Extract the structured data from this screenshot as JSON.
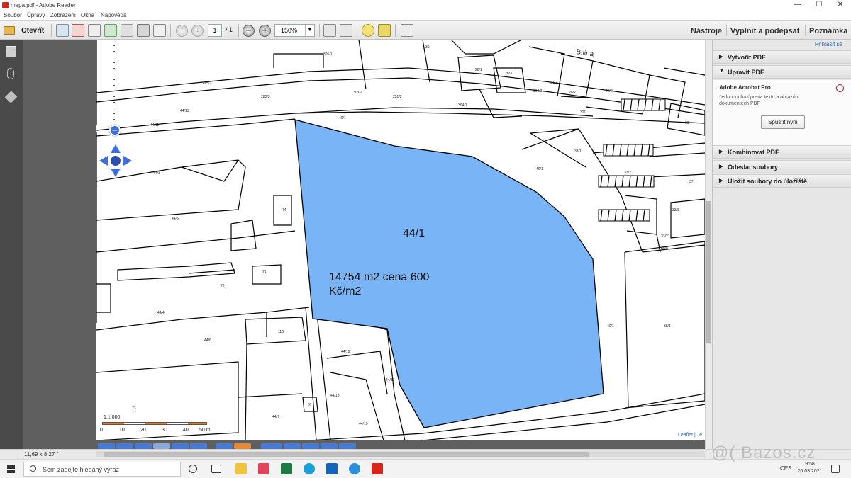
{
  "window": {
    "title": "mapa.pdf - Adobe Reader",
    "minimize": "—",
    "maximize": "☐",
    "close": "✕"
  },
  "menu": {
    "items": [
      "Soubor",
      "Úpravy",
      "Zobrazení",
      "Okna",
      "Nápověda"
    ]
  },
  "toolbar": {
    "open_label": "Otevřít",
    "page_current": "1",
    "page_total": "/ 1",
    "zoom": "150%",
    "minus": "−",
    "plus": "+",
    "tools_link": "Nástroje",
    "fill_sign_link": "Vyplnit a podepsat",
    "comment_link": "Poznámka"
  },
  "right_panel": {
    "signin": "Přihlásit se",
    "sections": [
      {
        "label": "Vytvořit PDF",
        "expanded": false
      },
      {
        "label": "Upravit PDF",
        "expanded": true
      },
      {
        "label": "Kombinovat PDF",
        "expanded": false
      },
      {
        "label": "Odeslat soubory",
        "expanded": false
      },
      {
        "label": "Uložit soubory do úložiště",
        "expanded": false
      }
    ],
    "expanded_title": "Adobe Acrobat Pro",
    "expanded_desc": "Jednoduchá úprava textu a obrazů v dokumentech PDF",
    "run_button": "Spustit nyní"
  },
  "map": {
    "parcel_label": "44/1",
    "parcel_text_line1": "14754 m2 cena 600",
    "parcel_text_line2": "Kč/m2",
    "parcel_color": "#79b4f6",
    "street_label": "Bílina",
    "scale_text": "1:1 000",
    "scale_ticks": [
      "0",
      "10",
      "20",
      "30",
      "40",
      "50 m"
    ],
    "attribution": "Leaflet | Je",
    "numbers": [
      "30",
      "305/1",
      "28/1",
      "28/3",
      "31/2",
      "28/2",
      "284/1",
      "280/3",
      "303/2",
      "251/2",
      "304/1",
      "304/3",
      "28/2",
      "32/1",
      "44/13",
      "44/11",
      "40/1",
      "39",
      "33/1",
      "40/1",
      "33/2",
      "37",
      "33/6",
      "33/21",
      "40/8",
      "44/3",
      "44/5",
      "74",
      "71",
      "70",
      "44/4",
      "116",
      "38/1",
      "40/1",
      "44/6",
      "44/19",
      "44/17",
      "44/18",
      "67",
      "44/7",
      "44/19",
      "73"
    ]
  },
  "status": {
    "dimensions": "11,69 x 8,27 \""
  },
  "taskbar": {
    "search_placeholder": "Sem zadejte hledaný výraz",
    "language": "CES",
    "time": "9:58",
    "date": "20.03.2021"
  },
  "watermark": "@( Bazos.cz"
}
